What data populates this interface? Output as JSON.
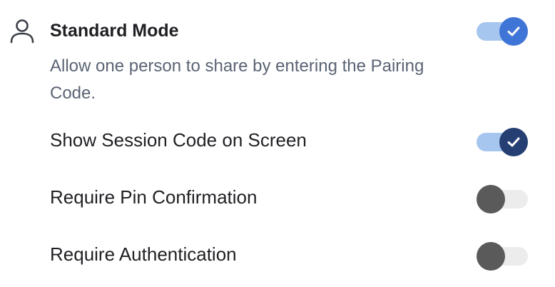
{
  "mode": {
    "icon": "person-icon",
    "title": "Standard Mode",
    "description": "Allow one person to share by entering the Pairing Code.",
    "toggle": {
      "on": true,
      "track_color": "#a6c6ef",
      "knob_color": "#3f75d6",
      "check_icon": "check-icon"
    }
  },
  "options": [
    {
      "label": "Show Session Code on Screen",
      "on": true,
      "track_color": "#a6c6ef",
      "knob_color": "#263f73",
      "check_icon": "check-icon"
    },
    {
      "label": "Require Pin Confirmation",
      "on": false,
      "track_color": "#ececec",
      "knob_color": "#5a5a5a"
    },
    {
      "label": "Require Authentication",
      "on": false,
      "track_color": "#ececec",
      "knob_color": "#5a5a5a"
    }
  ]
}
